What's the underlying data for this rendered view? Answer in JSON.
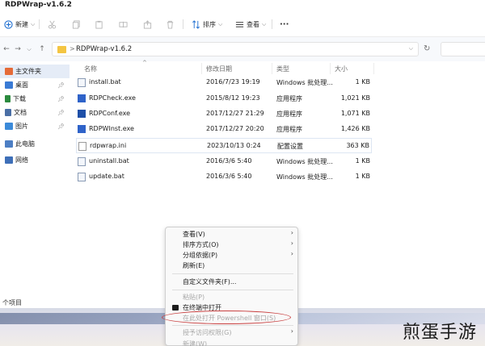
{
  "window": {
    "title": "RDPWrap-v1.6.2"
  },
  "toolbar": {
    "new_label": "新建",
    "new_dropdown": "⌵",
    "sort_label": "排序",
    "view_label": "查看",
    "more_label": "···"
  },
  "address": {
    "path": "RDPWrap-v1.6.2",
    "chevron": ">"
  },
  "sidebar": {
    "items": [
      {
        "label": "主文件夹",
        "color": "#e56b38"
      },
      {
        "label": "桌面",
        "color": "#3a7bd5",
        "pinned": true
      },
      {
        "label": "下载",
        "color": "#2b8a3e",
        "pinned": true
      },
      {
        "label": "文档",
        "color": "#4a6fa5",
        "pinned": true
      },
      {
        "label": "图片",
        "color": "#3b8ad9",
        "pinned": true
      },
      {
        "label": "此电脑",
        "color": "#4d7fc4"
      },
      {
        "label": "网络",
        "color": "#3e6fb8"
      }
    ]
  },
  "columns": {
    "name": "名称",
    "modified": "修改日期",
    "type": "类型",
    "size": "大小"
  },
  "files": [
    {
      "name": "install.bat",
      "modified": "2016/7/23 19:19",
      "type": "Windows 批处理...",
      "size": "1 KB",
      "icon": "bat-icon"
    },
    {
      "name": "RDPCheck.exe",
      "modified": "2015/8/12 19:23",
      "type": "应用程序",
      "size": "1,021 KB",
      "icon": "exe-icon"
    },
    {
      "name": "RDPConf.exe",
      "modified": "2017/12/27 21:29",
      "type": "应用程序",
      "size": "1,071 KB",
      "icon": "exe-icon"
    },
    {
      "name": "RDPWInst.exe",
      "modified": "2017/12/27 20:20",
      "type": "应用程序",
      "size": "1,426 KB",
      "icon": "exe-icon"
    },
    {
      "name": "rdpwrap.ini",
      "modified": "2023/10/13 0:24",
      "type": "配置设置",
      "size": "363 KB",
      "icon": "ini-icon"
    },
    {
      "name": "uninstall.bat",
      "modified": "2016/3/6 5:40",
      "type": "Windows 批处理...",
      "size": "1 KB",
      "icon": "bat-icon"
    },
    {
      "name": "update.bat",
      "modified": "2016/3/6 5:40",
      "type": "Windows 批处理...",
      "size": "1 KB",
      "icon": "bat-icon"
    }
  ],
  "status": {
    "count": "个项目"
  },
  "context_menu": {
    "items": [
      {
        "label": "查看(V)",
        "submenu": true
      },
      {
        "label": "排序方式(O)",
        "submenu": true
      },
      {
        "label": "分组依据(P)",
        "submenu": true
      },
      {
        "label": "刷新(E)"
      },
      {
        "label": "自定义文件夹(F)..."
      },
      {
        "label": "粘贴(P)",
        "disabled": true
      },
      {
        "label": "在终端中打开"
      },
      {
        "label": "在此处打开 Powershell 窗口(S)",
        "disabled": true
      },
      {
        "label": "授予访问权限(G)",
        "disabled": true,
        "submenu": true
      },
      {
        "label": "新建(W)",
        "disabled": true
      }
    ]
  },
  "watermark": "煎蛋手游"
}
